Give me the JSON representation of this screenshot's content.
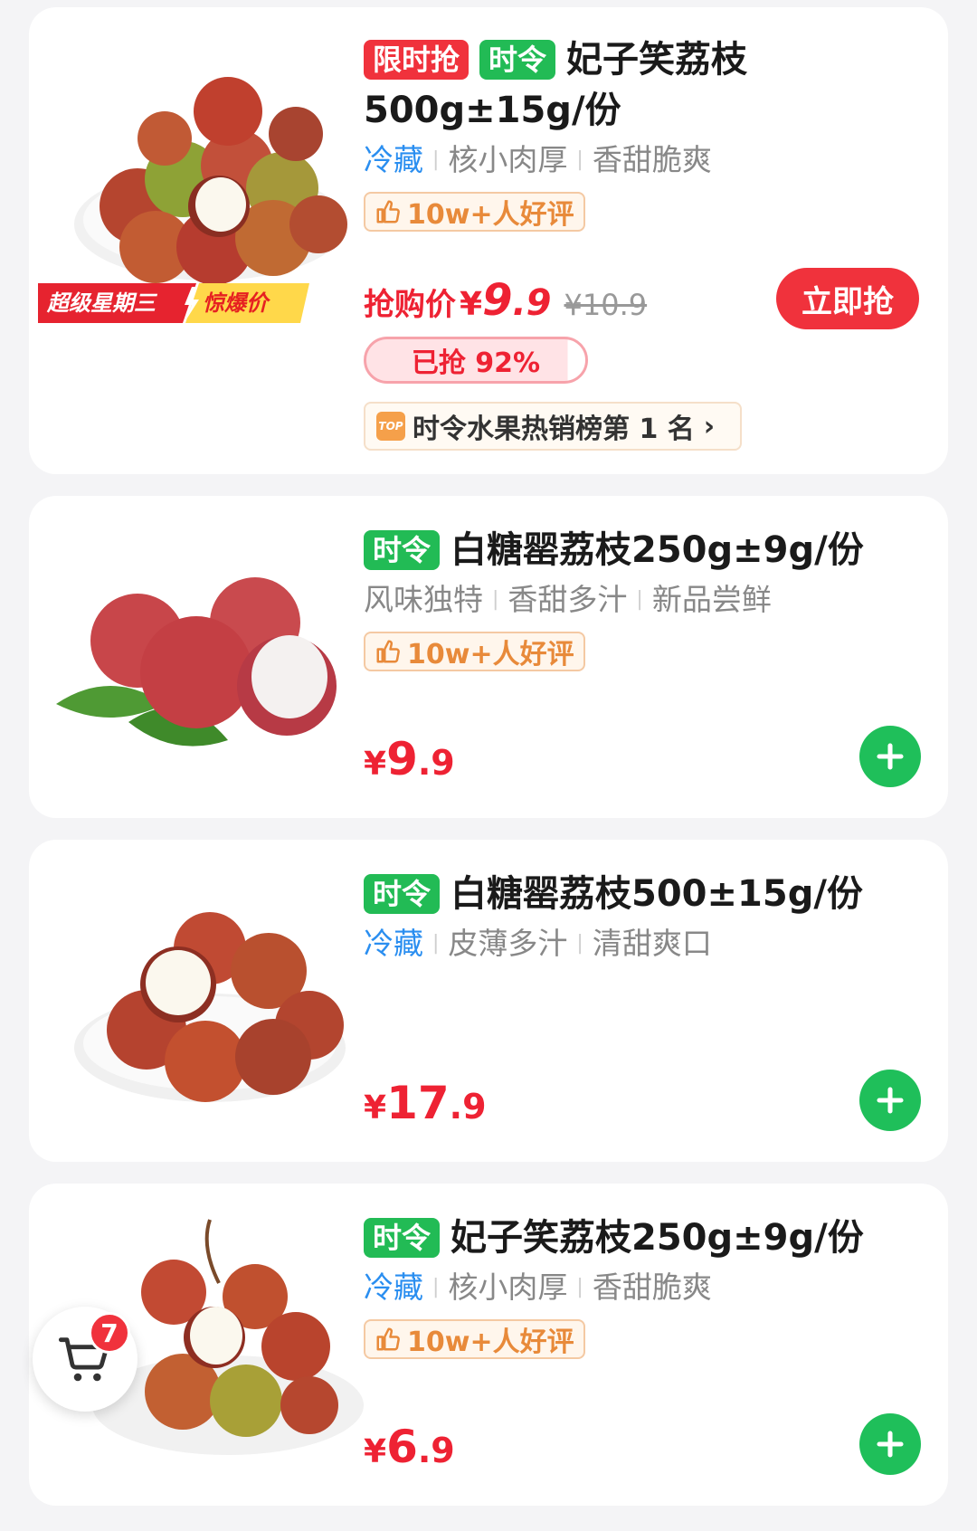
{
  "products": [
    {
      "tags": [
        "限时抢",
        "时令"
      ],
      "title_a": "妃子笑荔枝",
      "title_b": "500g±15g/份",
      "feature_cold": "冷藏",
      "features": [
        "核小肉厚",
        "香甜脆爽"
      ],
      "review": "10w+人好评",
      "banner_left": "超级星期三",
      "banner_right": "惊爆价",
      "price_prefix": "抢购价",
      "currency": "¥",
      "price_int": "9",
      "price_dec": ".9",
      "price_orig": "¥10.9",
      "buy_label": "立即抢",
      "progress_label": "已抢 92%",
      "progress_value": 0.92,
      "rank_badge": "TOP",
      "rank_text": "时令水果热销榜第 1 名",
      "rank_chevron": "›"
    },
    {
      "tags": [
        "时令"
      ],
      "title": "白糖罂荔枝250g±9g/份",
      "features": [
        "风味独特",
        "香甜多汁",
        "新品尝鲜"
      ],
      "review": "10w+人好评",
      "currency": "¥",
      "price_int": "9",
      "price_dec": ".9"
    },
    {
      "tags": [
        "时令"
      ],
      "title": "白糖罂荔枝500±15g/份",
      "feature_cold": "冷藏",
      "features": [
        "皮薄多汁",
        "清甜爽口"
      ],
      "currency": "¥",
      "price_int": "17",
      "price_dec": ".9"
    },
    {
      "tags": [
        "时令"
      ],
      "title": "妃子笑荔枝250g±9g/份",
      "feature_cold": "冷藏",
      "features": [
        "核小肉厚",
        "香甜脆爽"
      ],
      "review": "10w+人好评",
      "currency": "¥",
      "price_int": "6",
      "price_dec": ".9"
    }
  ],
  "cart": {
    "count": "7"
  },
  "colors": {
    "accent_red": "#f0323c",
    "accent_green": "#22bb55",
    "cold_blue": "#2a8ef0",
    "review_orange": "#e88a3a"
  },
  "icons": {
    "thumbs_up": "thumbs-up-icon",
    "plus": "plus-icon",
    "cart": "cart-icon",
    "chevron": "chevron-right-icon"
  }
}
